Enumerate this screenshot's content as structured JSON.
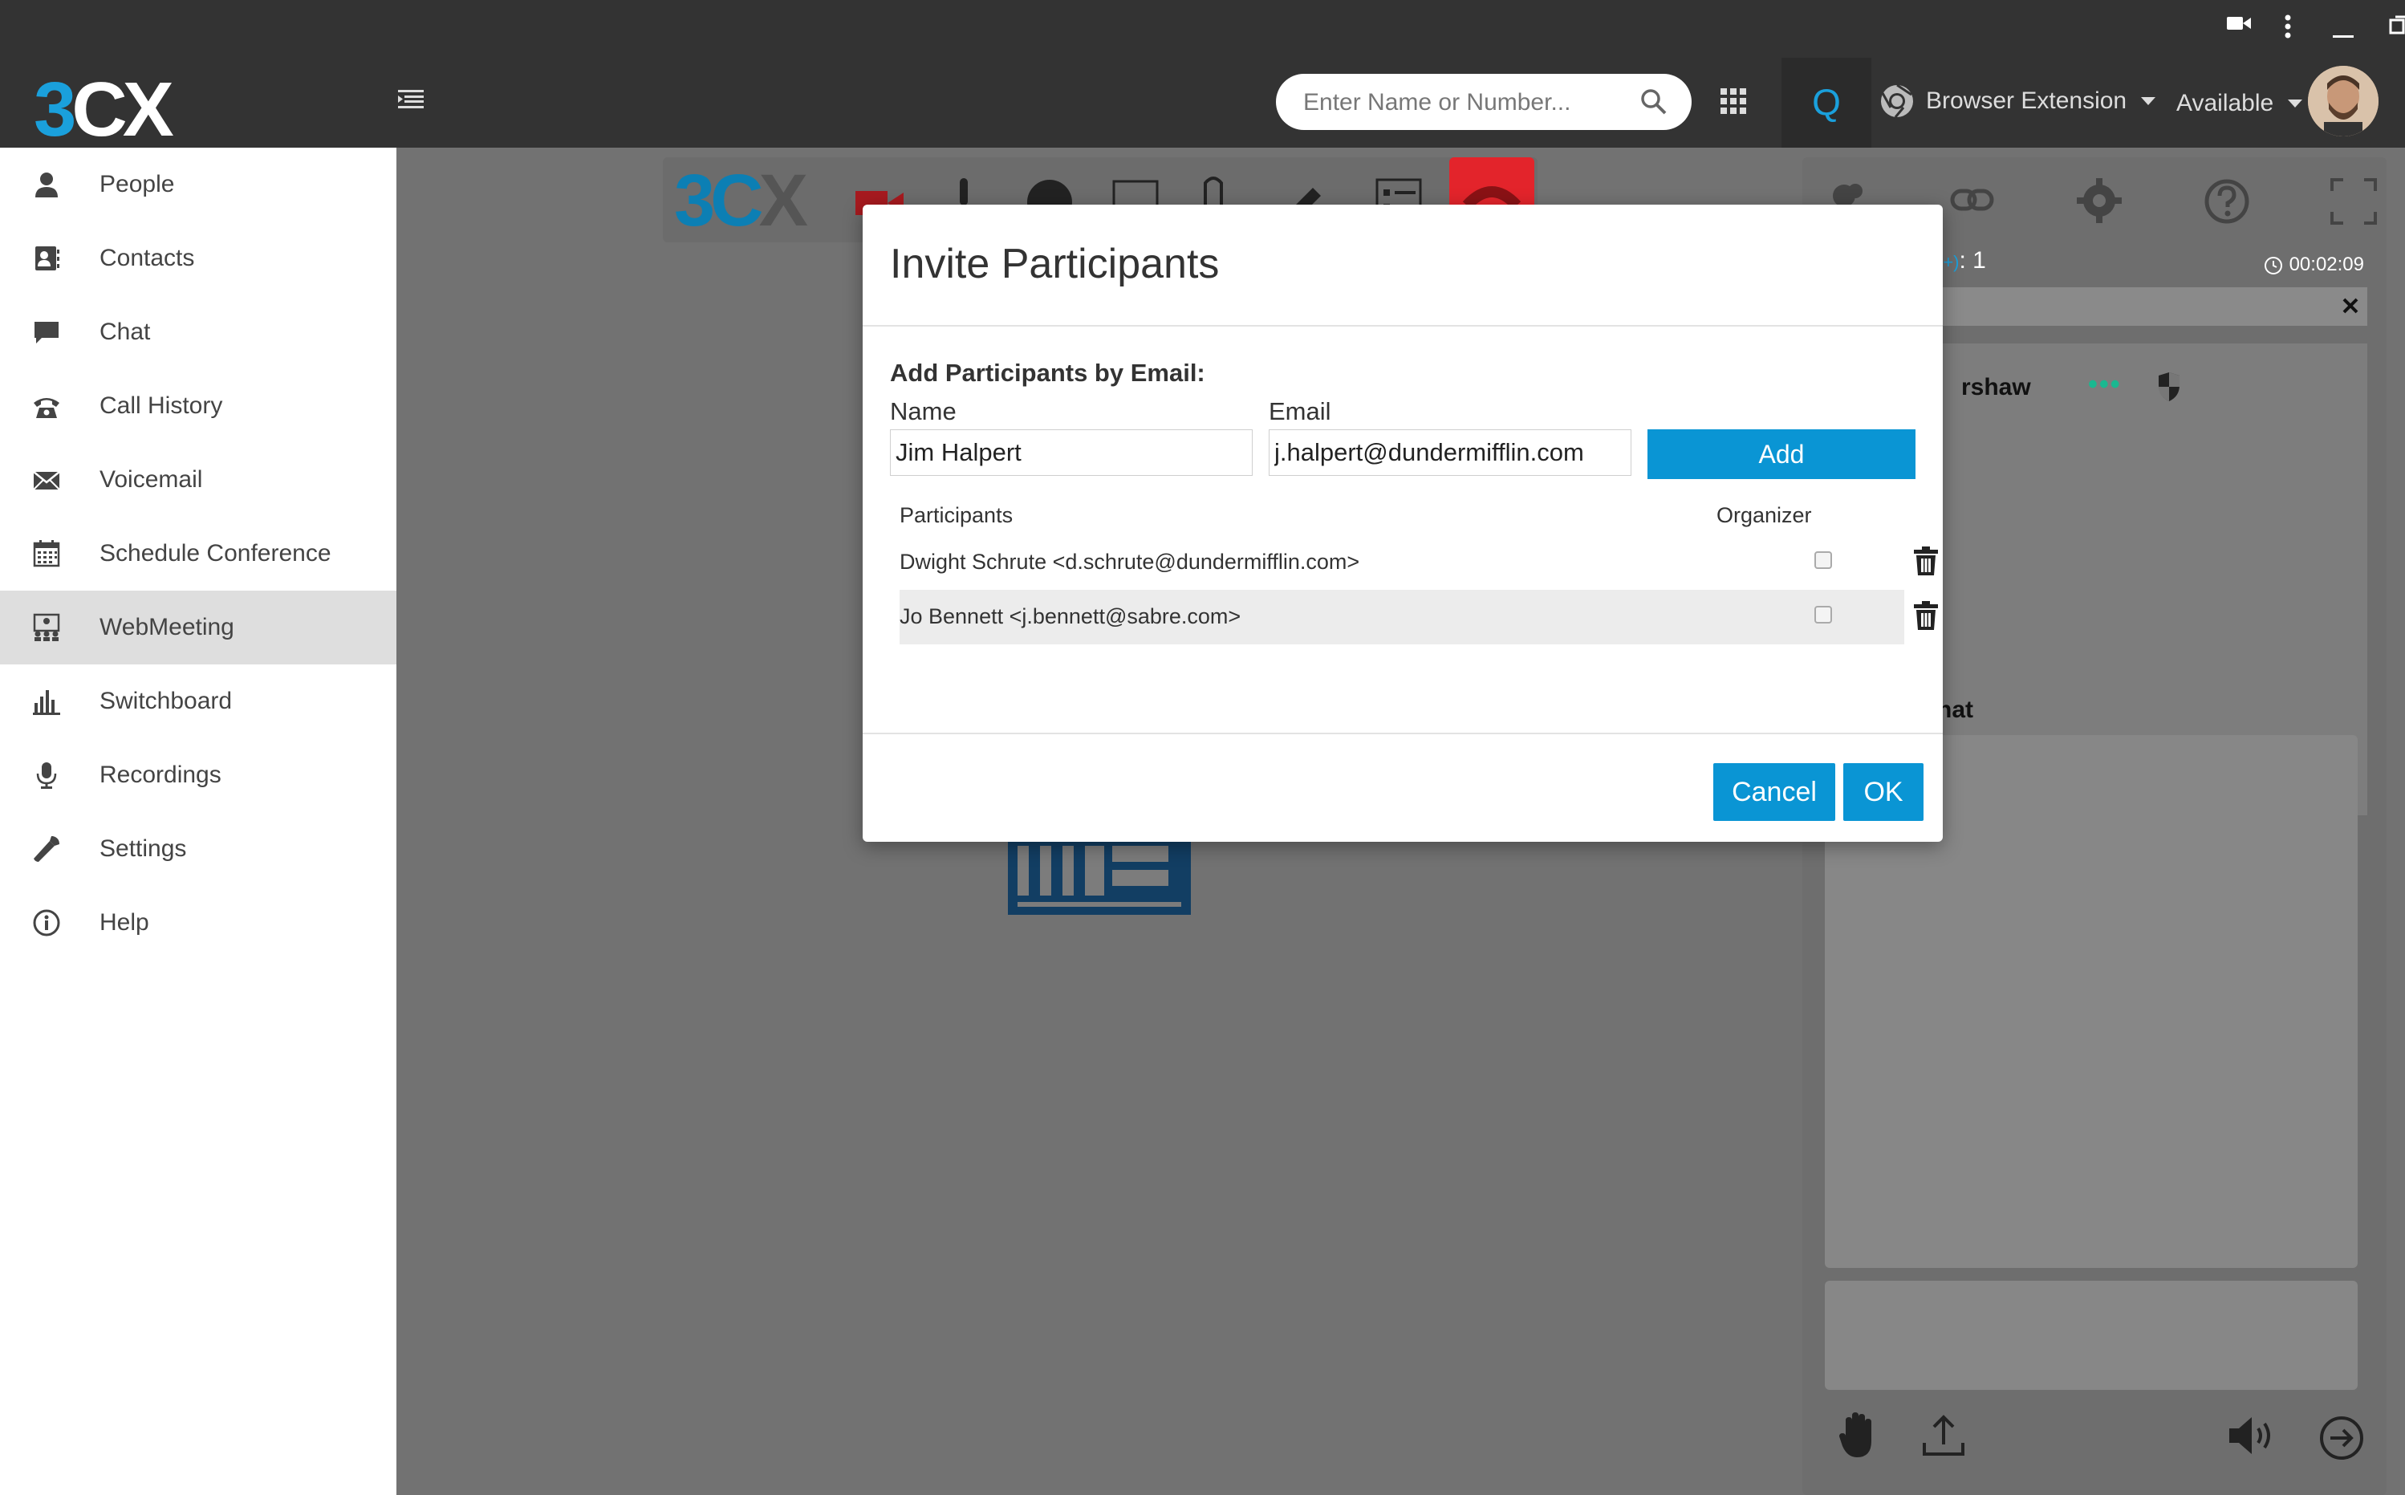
{
  "app": {
    "logo_3": "3",
    "logo_cx": "CX"
  },
  "header": {
    "search_placeholder": "Enter Name or Number...",
    "queue_label": "Q",
    "browser_extension": "Browser Extension",
    "status": "Available"
  },
  "sidebar": {
    "items": [
      {
        "label": "People",
        "icon": "person-icon"
      },
      {
        "label": "Contacts",
        "icon": "contacts-icon"
      },
      {
        "label": "Chat",
        "icon": "chat-icon"
      },
      {
        "label": "Call History",
        "icon": "phone-icon"
      },
      {
        "label": "Voicemail",
        "icon": "envelope-icon"
      },
      {
        "label": "Schedule Conference",
        "icon": "calendar-icon"
      },
      {
        "label": "WebMeeting",
        "icon": "webmeeting-icon",
        "active": true
      },
      {
        "label": "Switchboard",
        "icon": "bar-chart-icon"
      },
      {
        "label": "Recordings",
        "icon": "microphone-icon"
      },
      {
        "label": "Settings",
        "icon": "wrench-icon"
      },
      {
        "label": "Help",
        "icon": "info-icon"
      }
    ]
  },
  "meeting": {
    "logo_a": "3C",
    "logo_b": "X",
    "participant_count_prefix": "(+)",
    "participant_count": ": 1",
    "timer": "00:02:09",
    "participant_name_fragment": "rshaw",
    "chat_title_fragment": "hat"
  },
  "modal": {
    "title": "Invite Participants",
    "section_label": "Add Participants by Email:",
    "name_label": "Name",
    "email_label": "Email",
    "name_value": "Jim Halpert",
    "email_value": "j.halpert@dundermifflin.com",
    "add_label": "Add",
    "col_participants": "Participants",
    "col_organizer": "Organizer",
    "participants": [
      {
        "text": "Dwight Schrute <d.schrute@dundermifflin.com>",
        "organizer": false
      },
      {
        "text": "Jo Bennett <j.bennett@sabre.com>",
        "organizer": false
      }
    ],
    "cancel_label": "Cancel",
    "ok_label": "OK"
  },
  "colors": {
    "accent": "#0a95d4",
    "brand_blue": "#1aa0dc",
    "topbar": "#333333",
    "leave_red": "#e3242b"
  }
}
